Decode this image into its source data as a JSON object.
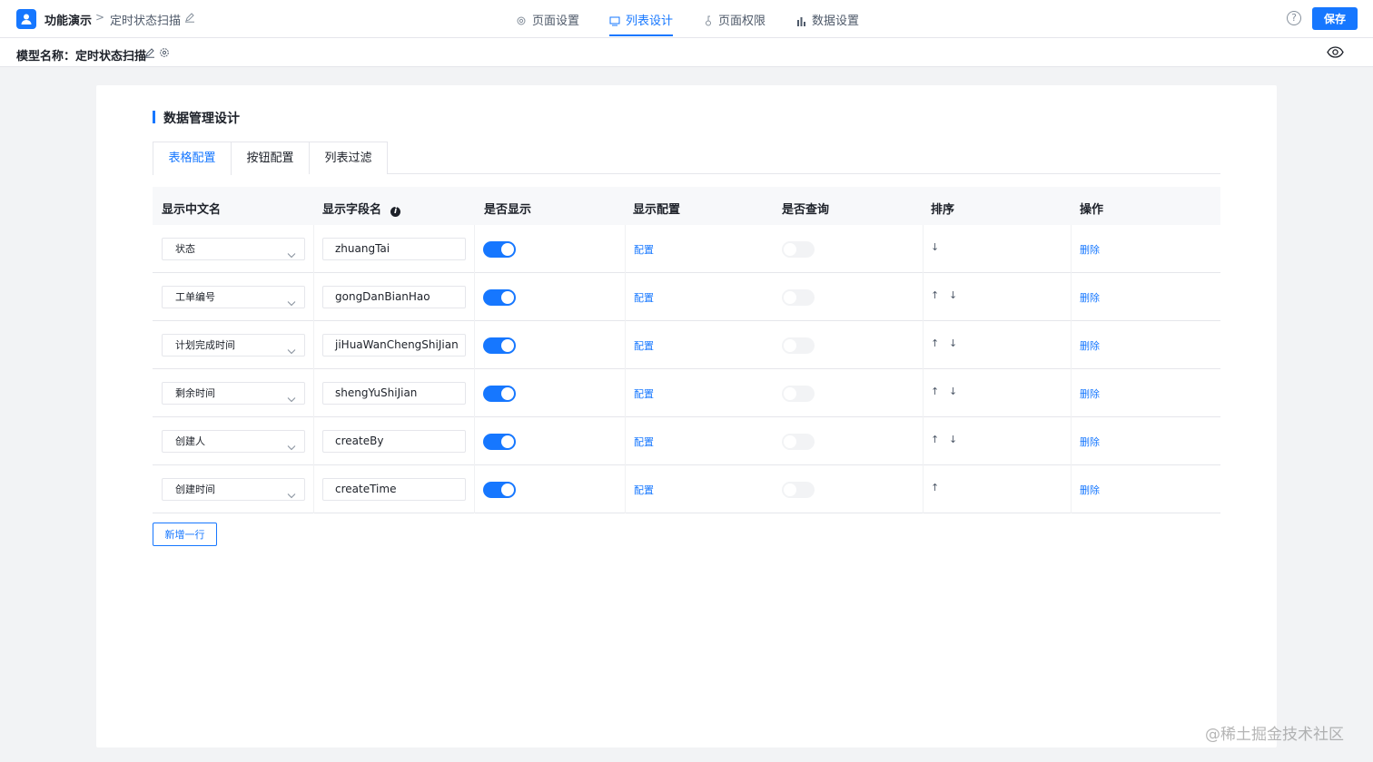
{
  "header": {
    "app_name": "功能演示",
    "breadcrumb_sep": ">",
    "page_name": "定时状态扫描",
    "tabs": [
      {
        "label": "页面设置",
        "icon": "gear-icon"
      },
      {
        "label": "列表设计",
        "icon": "list-icon",
        "active": true
      },
      {
        "label": "页面权限",
        "icon": "key-icon"
      },
      {
        "label": "数据设置",
        "icon": "bar-chart-icon"
      }
    ],
    "help": "?",
    "save_label": "保存"
  },
  "subheader": {
    "model_label": "模型名称：定时状态扫描"
  },
  "section": {
    "title": "数据管理设计",
    "tabs": [
      {
        "label": "表格配置",
        "active": true
      },
      {
        "label": "按钮配置"
      },
      {
        "label": "列表过滤"
      }
    ]
  },
  "table": {
    "columns": [
      "显示中文名",
      "显示字段名",
      "是否显示",
      "显示配置",
      "是否查询",
      "排序",
      "操作"
    ],
    "info": "i",
    "config_label": "配置",
    "delete_label": "删除",
    "up_arrow": "↑",
    "down_arrow": "↓",
    "rows": [
      {
        "cn_name": "状态",
        "field": "zhuangTai",
        "show": true,
        "query": false,
        "up": false,
        "down": true
      },
      {
        "cn_name": "工单编号",
        "field": "gongDanBianHao",
        "show": true,
        "query": false,
        "up": true,
        "down": true
      },
      {
        "cn_name": "计划完成时间",
        "field": "jiHuaWanChengShiJian",
        "show": true,
        "query": false,
        "up": true,
        "down": true
      },
      {
        "cn_name": "剩余时间",
        "field": "shengYuShiJian",
        "show": true,
        "query": false,
        "up": true,
        "down": true
      },
      {
        "cn_name": "创建人",
        "field": "createBy",
        "show": true,
        "query": false,
        "up": true,
        "down": true
      },
      {
        "cn_name": "创建时间",
        "field": "createTime",
        "show": true,
        "query": false,
        "up": true,
        "down": false
      }
    ]
  },
  "add_row_label": "新增一行",
  "watermark": "@稀土掘金技术社区",
  "colors": {
    "primary": "#1677ff",
    "background": "#f2f3f5",
    "border": "#e5e6eb"
  }
}
